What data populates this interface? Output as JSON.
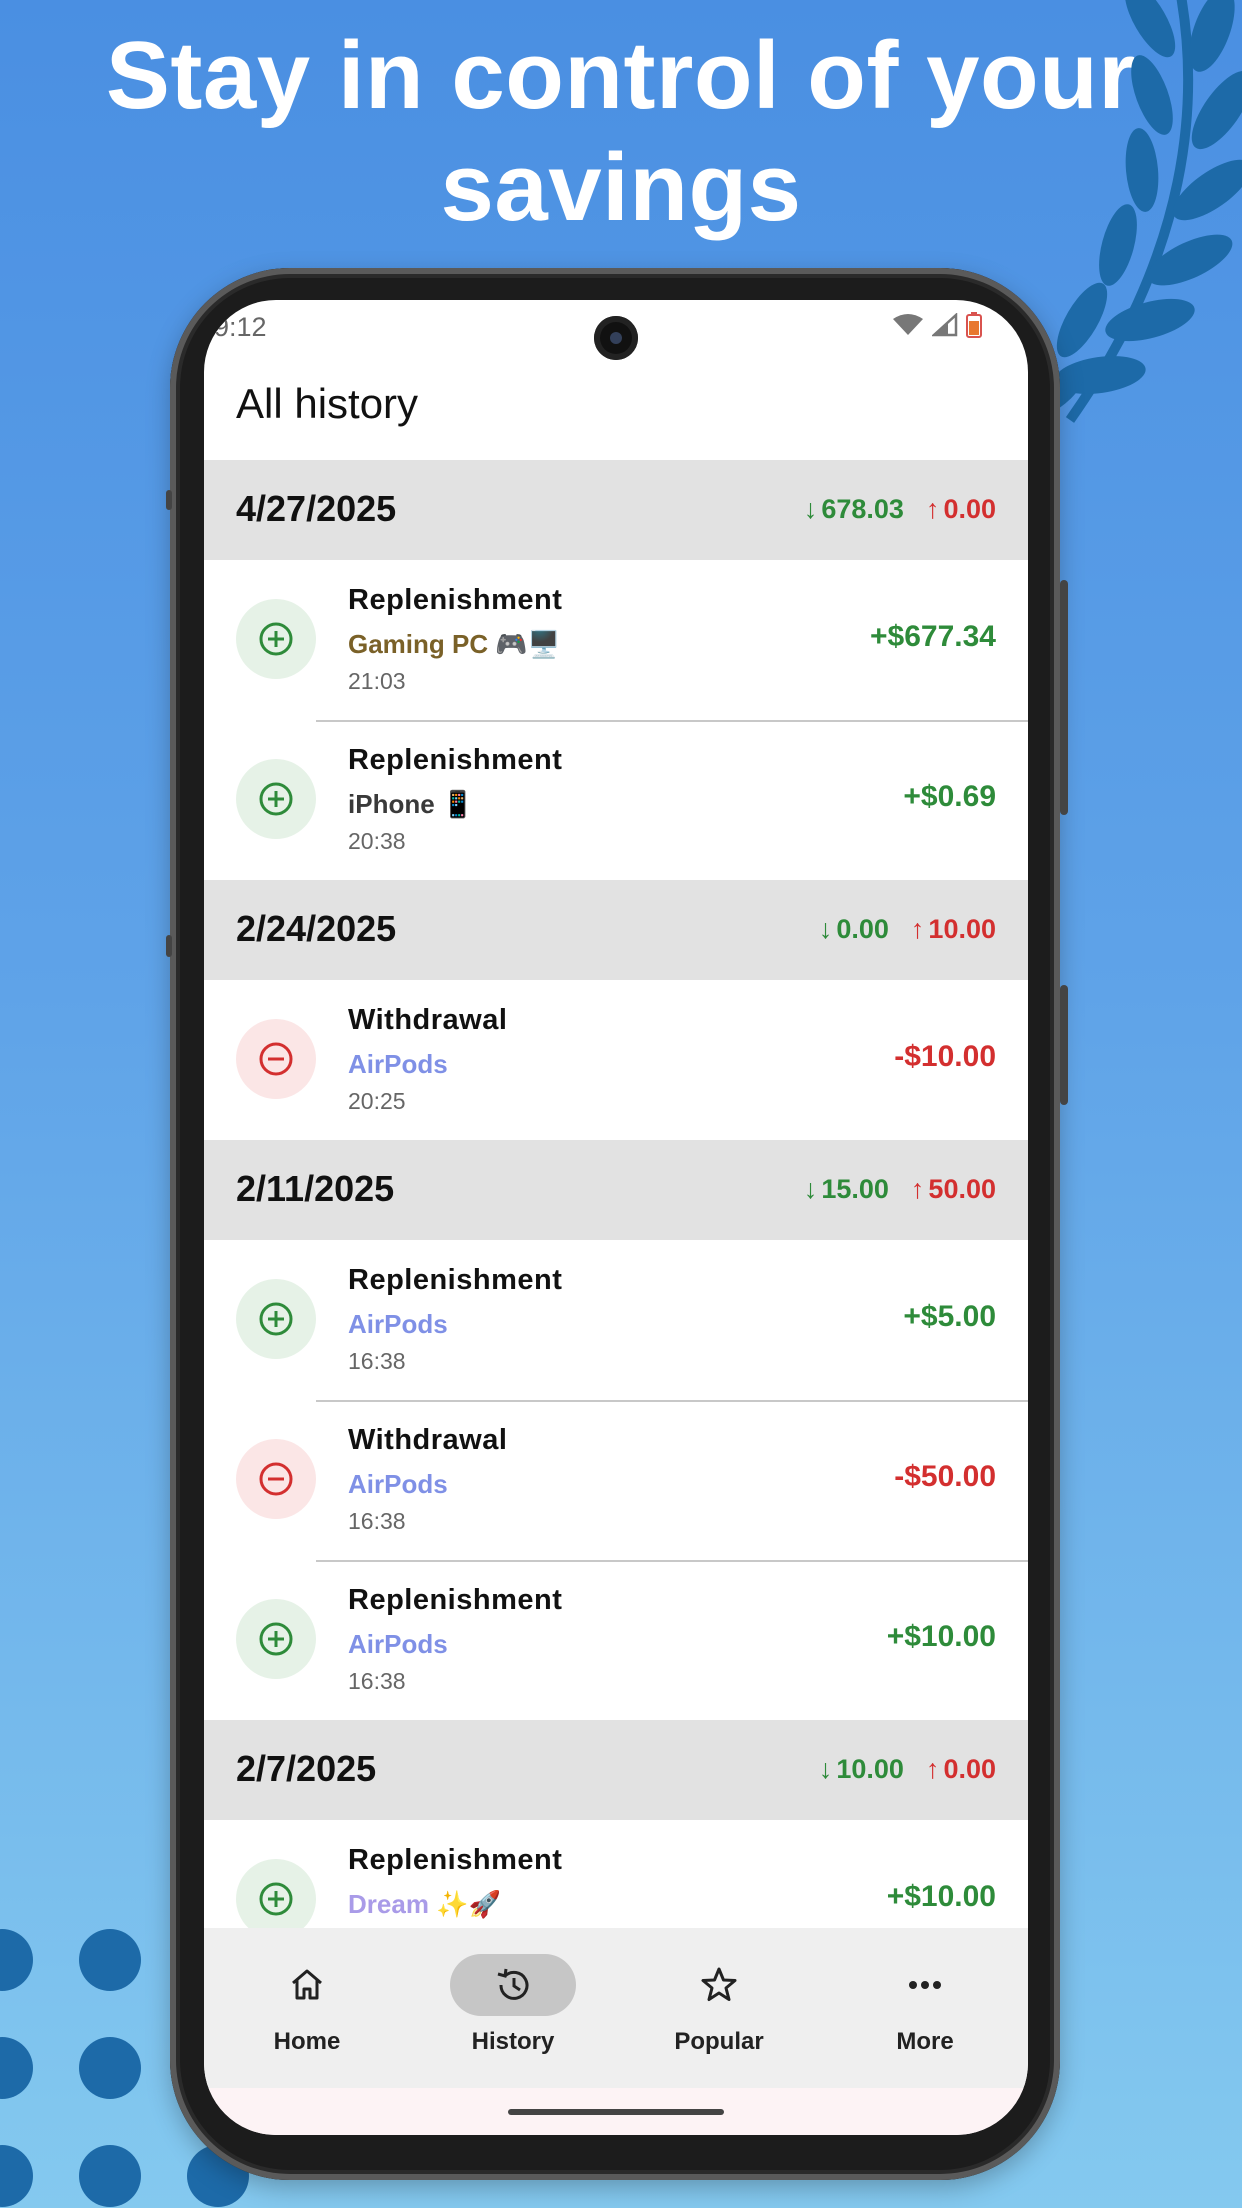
{
  "headline": "Stay in control of your savings",
  "status_bar": {
    "time": "9:12"
  },
  "app_bar": {
    "title": "All history"
  },
  "colors": {
    "income": "#2e8b3a",
    "expense": "#d32f2f",
    "header_bg": "#e2e2e2"
  },
  "groups": [
    {
      "date": "4/27/2025",
      "total_in": "678.03",
      "total_out": "0.00",
      "transactions": [
        {
          "type": "Replenishment",
          "goal": "Gaming PC 🎮🖥️",
          "goal_color": "#7a6128",
          "time": "21:03",
          "amount": "+$677.34",
          "kind": "plus"
        },
        {
          "type": "Replenishment",
          "goal": "iPhone 📱",
          "goal_color": "#3a3a3a",
          "time": "20:38",
          "amount": "+$0.69",
          "kind": "plus"
        }
      ]
    },
    {
      "date": "2/24/2025",
      "total_in": "0.00",
      "total_out": "10.00",
      "transactions": [
        {
          "type": "Withdrawal",
          "goal": "AirPods",
          "goal_color": "#7f90e6",
          "time": "20:25",
          "amount": "-$10.00",
          "kind": "minus"
        }
      ]
    },
    {
      "date": "2/11/2025",
      "total_in": "15.00",
      "total_out": "50.00",
      "transactions": [
        {
          "type": "Replenishment",
          "goal": "AirPods",
          "goal_color": "#7f90e6",
          "time": "16:38",
          "amount": "+$5.00",
          "kind": "plus"
        },
        {
          "type": "Withdrawal",
          "goal": "AirPods",
          "goal_color": "#7f90e6",
          "time": "16:38",
          "amount": "-$50.00",
          "kind": "minus"
        },
        {
          "type": "Replenishment",
          "goal": "AirPods",
          "goal_color": "#7f90e6",
          "time": "16:38",
          "amount": "+$10.00",
          "kind": "plus"
        }
      ]
    },
    {
      "date": "2/7/2025",
      "total_in": "10.00",
      "total_out": "0.00",
      "transactions": [
        {
          "type": "Replenishment",
          "goal": "Dream ✨🚀",
          "goal_color": "#a99be8",
          "time": "",
          "amount": "+$10.00",
          "kind": "plus"
        }
      ]
    }
  ],
  "nav": {
    "items": [
      {
        "label": "Home",
        "icon": "home-icon",
        "active": false
      },
      {
        "label": "History",
        "icon": "history-icon",
        "active": true
      },
      {
        "label": "Popular",
        "icon": "star-icon",
        "active": false
      },
      {
        "label": "More",
        "icon": "more-horizontal-icon",
        "active": false
      }
    ]
  }
}
